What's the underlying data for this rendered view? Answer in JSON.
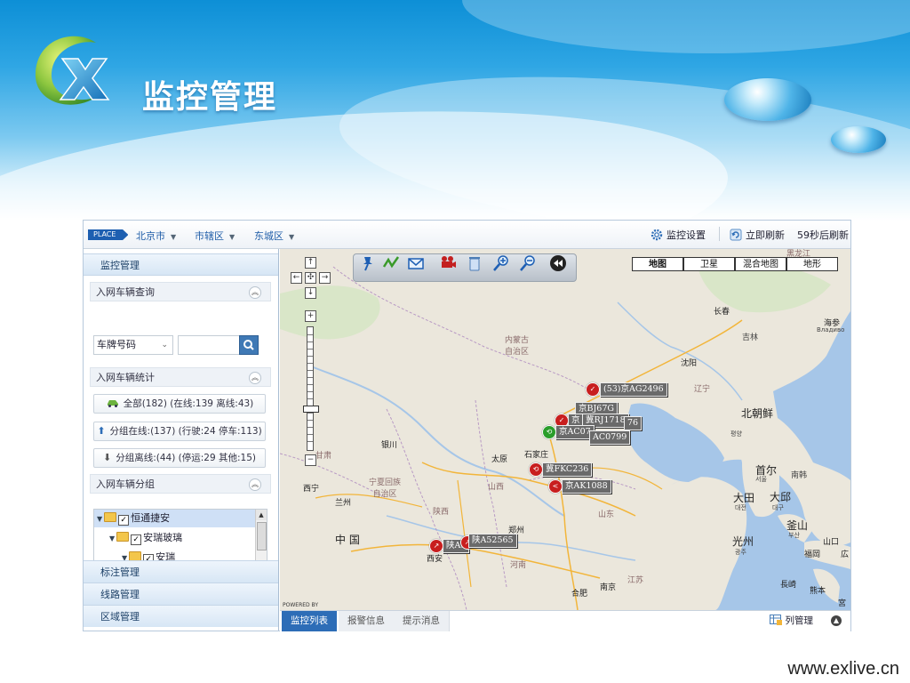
{
  "slide": {
    "title": "监控管理",
    "footer_url": "www.exlive.cn"
  },
  "topbar": {
    "place_badge": "PLACE",
    "breadcrumbs": [
      "北京市",
      "市辖区",
      "东城区"
    ],
    "monitor_settings": "监控设置",
    "refresh_now": "立即刷新",
    "refresh_countdown": "59秒后刷新"
  },
  "sidebar": {
    "header": "监控管理",
    "vehicle_query": {
      "title": "入网车辆查询",
      "select_value": "车牌号码",
      "search_value": ""
    },
    "vehicle_stats": {
      "title": "入网车辆统计",
      "all": "全部(182) (在线:139 离线:43)",
      "online": "分组在线:(137) (行驶:24 停车:113)",
      "offline": "分组离线:(44) (停运:29 其他:15)"
    },
    "vehicle_group": {
      "title": "入网车辆分组",
      "tree": [
        "恒通捷安",
        "安瑞玻璃",
        "安瑞"
      ]
    },
    "bottom_nav": [
      "标注管理",
      "线路管理",
      "区域管理"
    ]
  },
  "map": {
    "types": [
      "地图",
      "卫星",
      "混合地图",
      "地形"
    ],
    "active_type": "地图",
    "powered_by": "POWERED BY",
    "tools": [
      "pushpin-icon",
      "route-icon",
      "mail-icon",
      "camera-icon",
      "trash-icon",
      "zoom-in-icon",
      "zoom-out-icon",
      "rewind-icon"
    ],
    "labels": {
      "heilongjiang": "黑龙江",
      "changchun": "长春",
      "jilin": "吉林",
      "haishenwai": "海参",
      "vladivostok": "Владиво",
      "nei_menggu": "内蒙古\n自治区",
      "shenyang": "沈阳",
      "liaoning": "辽宁",
      "north_korea": "北朝鲜",
      "pyongyang": "평양",
      "yinchuan": "银川",
      "gansu": "甘肃",
      "ningxia": "宁夏回族\n自治区",
      "taiyuan": "太原",
      "shijiazhuang": "石家庄",
      "shanxi": "山西",
      "seoul": "首尔",
      "seoul_kr": "서울",
      "south_korea": "南韩",
      "xining": "西宁",
      "lanzhou": "兰州",
      "shaanxi": "陕西",
      "shandong": "山东",
      "daejeon": "大田",
      "daejeon_kr": "대전",
      "daegu": "大邱",
      "daegu_kr": "대구",
      "busan": "釜山",
      "busan_kr": "부산",
      "gwangju": "光州",
      "gwangju_kr": "광주",
      "zhengzhou": "郑州",
      "china": "中 国",
      "xian": "西安",
      "henan": "河南",
      "jiangsu": "江苏",
      "hefei": "合肥",
      "nanjing": "南京",
      "fukuoka": "福岡",
      "yamaguchi": "山口",
      "hiroshima": "広",
      "nagasaki": "長崎",
      "kumamoto": "熊本",
      "miyazaki": "宮"
    },
    "vehicles": [
      {
        "label": "(53)京AG2496",
        "color": "#c81e1e"
      },
      {
        "label": "京BJ67G",
        "color": "#c81e1e"
      },
      {
        "label": "京",
        "color": "#c81e1e"
      },
      {
        "label": "冀RJ1718",
        "color": "#c81e1e"
      },
      {
        "label": "76",
        "color": "#c81e1e"
      },
      {
        "label": "京AC07",
        "color": "#2a9d2a"
      },
      {
        "label": "AC0799",
        "color": "#c81e1e"
      },
      {
        "label": "冀FKC236",
        "color": "#c81e1e"
      },
      {
        "label": "京AK1088",
        "color": "#c81e1e"
      },
      {
        "label": "陕A5",
        "color": "#c81e1e"
      },
      {
        "label": "陕A52565",
        "color": "#c81e1e"
      }
    ]
  },
  "bottombar": {
    "tabs": [
      "监控列表",
      "报警信息",
      "提示消息"
    ],
    "active_tab": "监控列表",
    "column_manager": "列管理"
  },
  "colors": {
    "accent": "#2d6db7",
    "brand_blue": "#1d5fb1",
    "vehicle_alarm": "#c81e1e",
    "vehicle_ok": "#2a9d2a"
  }
}
